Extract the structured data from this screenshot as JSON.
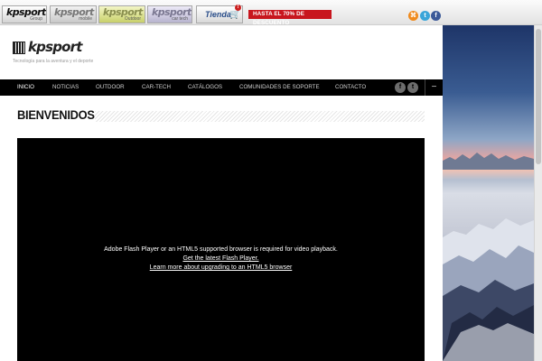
{
  "topbar": {
    "brands": [
      {
        "logo": "kpsport",
        "sub": "Group"
      },
      {
        "logo": "kpsport",
        "sub": "mobile"
      },
      {
        "logo": "kpsport",
        "sub": "Outdoor"
      },
      {
        "logo": "kpsport",
        "sub": "car tech"
      }
    ],
    "shop_label": "Tienda",
    "promo": "HASTA EL 70% DE DESCUENTO"
  },
  "header": {
    "logo": "kpsport",
    "tagline": "Tecnología para la aventura y el deporte"
  },
  "nav": {
    "items": [
      "INICIO",
      "NOTICIAS",
      "OUTDOOR",
      "CAR-TECH",
      "CATÁLOGOS",
      "COMUNIDADES DE SOPORTE",
      "CONTACTO"
    ],
    "active": "INICIO",
    "toggle": "−"
  },
  "main": {
    "title": "BIENVENIDOS",
    "video": {
      "message": "Adobe Flash Player or an HTML5 supported browser is required for video playback.",
      "link_flash": "Get the latest Flash Player.",
      "link_html5": "Learn more about upgrading to an HTML5 browser"
    }
  },
  "icons": {
    "rss": "rss-icon",
    "twitter": "twitter-icon",
    "facebook": "facebook-icon",
    "cart": "cart-icon",
    "qr": "qr-code-icon"
  },
  "colors": {
    "promo": "#c8161e",
    "nav_bg": "#000000",
    "video_bg": "#000000",
    "rss": "#f08a1c",
    "twitter": "#3aa5d9",
    "facebook": "#3b5998"
  }
}
